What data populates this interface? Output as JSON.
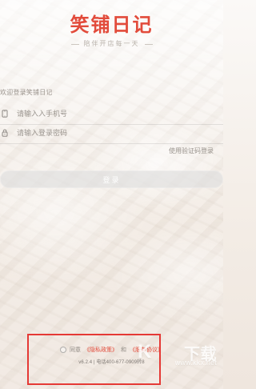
{
  "brand": {
    "title": "笑铺日记",
    "slogan": "陪伴开店每一天"
  },
  "login": {
    "hint": "欢迎登录笑铺日记",
    "phone_placeholder": "请输入入手机号",
    "password_placeholder": "请输入登录密码",
    "code_login_link": "使用验证码登录",
    "login_button": "登录"
  },
  "agreement": {
    "prefix": "同意",
    "privacy_policy": "《隐私政策》",
    "and": "和",
    "service_agreement": "《服务协议》",
    "version_line": "v6.2.4 | 电话400-677-0909转8"
  },
  "icons": {
    "phone": "phone-icon",
    "lock": "lock-icon"
  },
  "colors": {
    "brand_red": "#e24b3b",
    "highlight_red": "#e53935"
  },
  "watermark": {
    "main": "下载",
    "domain": "www.kkx.net"
  }
}
